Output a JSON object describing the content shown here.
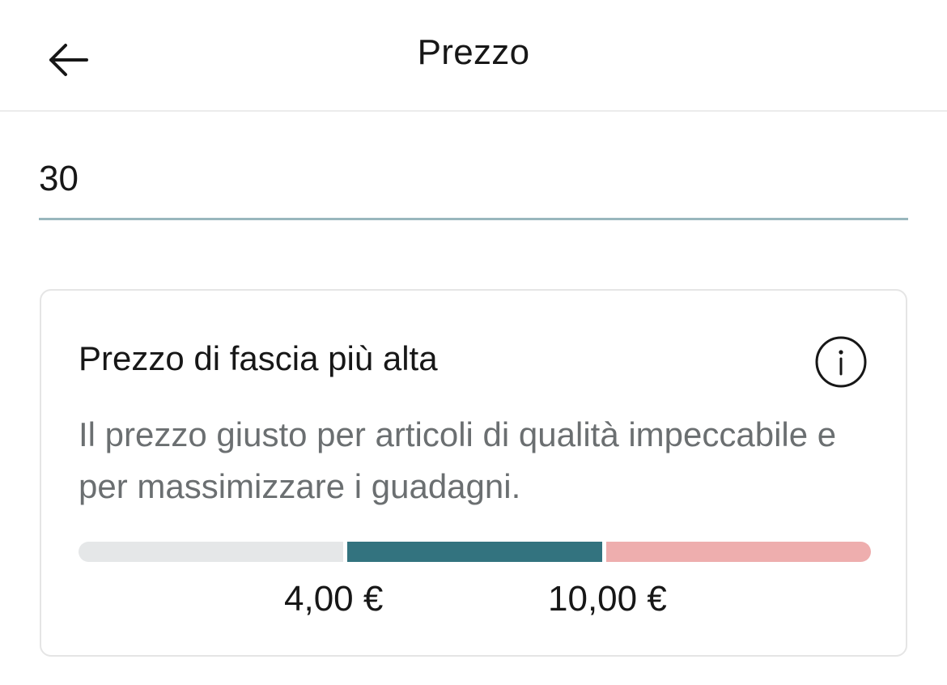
{
  "header": {
    "title": "Prezzo",
    "back_icon": "arrow-left-icon"
  },
  "price_field": {
    "value": "30"
  },
  "suggestion_card": {
    "title": "Prezzo di fascia più alta",
    "info_icon": "info-circle-icon",
    "description": "Il prezzo giusto per articoli di qualità impeccabile e per massimizzare i guadagni.",
    "range": {
      "min_label": "4,00 €",
      "max_label": "10,00 €",
      "colors": {
        "low": "#e5e7e8",
        "recommended": "#33737f",
        "high": "#eeaeae"
      }
    }
  }
}
